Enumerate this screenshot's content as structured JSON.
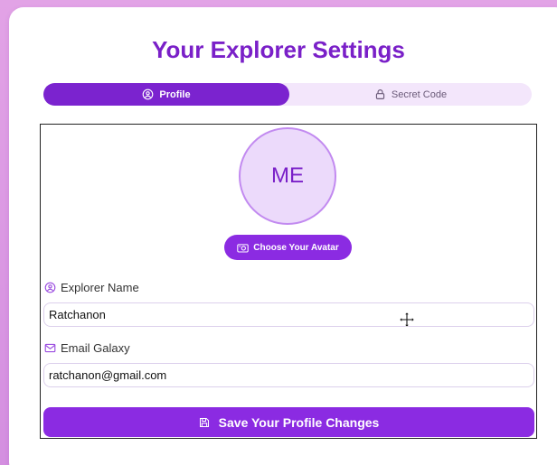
{
  "page": {
    "title": "Your Explorer Settings"
  },
  "tabs": [
    {
      "label": "Profile",
      "icon": "user-circle-icon",
      "active": true
    },
    {
      "label": "Secret Code",
      "icon": "lock-icon",
      "active": false
    }
  ],
  "profile": {
    "avatar_text": "ME",
    "avatar_button_label": "Choose Your Avatar",
    "name_label": "Explorer Name",
    "name_value": "Ratchanon",
    "email_label": "Email Galaxy",
    "email_value": "ratchanon@gmail.com",
    "save_label": "Save Your Profile Changes"
  },
  "colors": {
    "accent": "#8b2be2",
    "title": "#7a20c8",
    "tab_track": "#f3e6fb",
    "avatar_fill": "#ecdafb"
  }
}
